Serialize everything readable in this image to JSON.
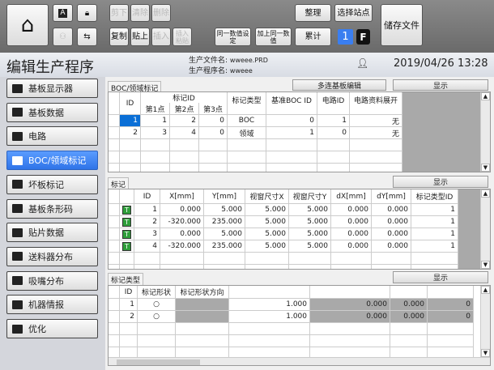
{
  "toolbar": {
    "cut": "剪下",
    "clear": "清除",
    "delete": "删除",
    "copy": "复制",
    "paste": "贴上",
    "insert": "插入",
    "insert_paste": "插入粘贴",
    "same_value": "同一数值设定",
    "add_same": "加上同一数值",
    "organize": "整理",
    "select_station": "选择站点",
    "accumulate": "累计",
    "station_num": "1",
    "f_badge": "F",
    "save_file": "储存文件"
  },
  "header": {
    "title": "编辑生产程序",
    "file_label": "生产文件名",
    "file_value": "wweee.PRD",
    "program_label": "生产程序名",
    "program_value": "wweee",
    "datetime": "2019/04/26 13:28"
  },
  "sidebar": {
    "items": [
      {
        "label": "基板显示器"
      },
      {
        "label": "基板数据"
      },
      {
        "label": "电路"
      },
      {
        "label": "BOC/领域标记",
        "active": true
      },
      {
        "label": "坏板标记"
      },
      {
        "label": "基板条形码"
      },
      {
        "label": "贴片数据"
      },
      {
        "label": "送料器分布"
      },
      {
        "label": "吸嘴分布"
      },
      {
        "label": "机器情报"
      },
      {
        "label": "优化"
      }
    ]
  },
  "boc": {
    "tab": "BOC/领域标记",
    "multi_edit": "多连基板编辑",
    "show": "显示",
    "headers": {
      "id": "ID",
      "mark_id": "标记ID",
      "p1": "第1点",
      "p2": "第2点",
      "p3": "第3点",
      "type": "标记类型",
      "base": "基准BOC ID",
      "circuit": "电路ID",
      "expand": "电路资料展开"
    },
    "rows": [
      [
        "1",
        "1",
        "2",
        "0",
        "BOC",
        "0",
        "1",
        "无"
      ],
      [
        "2",
        "3",
        "4",
        "0",
        "领域",
        "1",
        "0",
        "无"
      ]
    ]
  },
  "marks": {
    "tab": "标记",
    "show": "显示",
    "badge": "T",
    "headers": [
      "ID",
      "X[mm]",
      "Y[mm]",
      "视窗尺寸X",
      "视窗尺寸Y",
      "dX[mm]",
      "dY[mm]",
      "标记类型ID"
    ],
    "rows": [
      [
        "1",
        "0.000",
        "5.000",
        "5.000",
        "5.000",
        "0.000",
        "0.000",
        "1"
      ],
      [
        "2",
        "-320.000",
        "235.000",
        "5.000",
        "5.000",
        "0.000",
        "0.000",
        "1"
      ],
      [
        "3",
        "0.000",
        "5.000",
        "5.000",
        "5.000",
        "0.000",
        "0.000",
        "1"
      ],
      [
        "4",
        "-320.000",
        "235.000",
        "5.000",
        "5.000",
        "0.000",
        "0.000",
        "1"
      ]
    ]
  },
  "marktype": {
    "tab": "标记类型",
    "show": "显示",
    "headers": [
      "ID",
      "标记形状",
      "标记形状方向"
    ],
    "rows": [
      [
        "1",
        "○",
        "",
        "1.000",
        "0.000",
        "0.000",
        "0"
      ],
      [
        "2",
        "○",
        "",
        "1.000",
        "0.000",
        "0.000",
        "0"
      ]
    ]
  }
}
